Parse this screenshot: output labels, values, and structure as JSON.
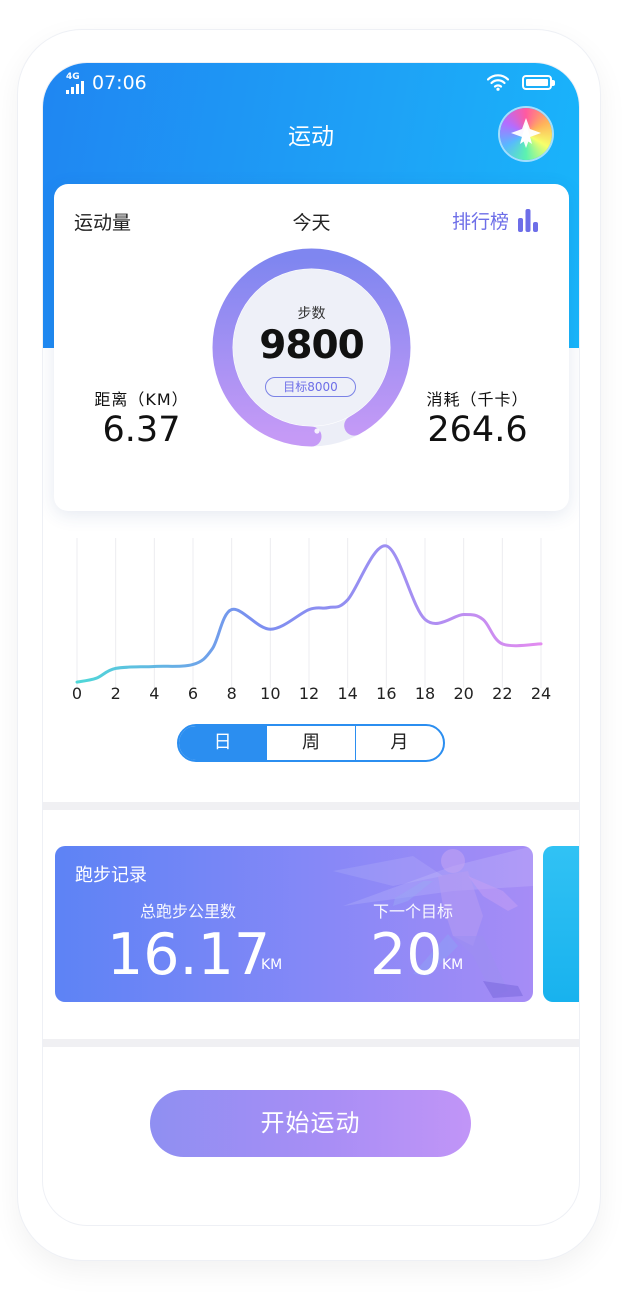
{
  "status": {
    "network": "4G",
    "time": "07:06"
  },
  "header": {
    "title": "运动"
  },
  "summary": {
    "label_left": "运动量",
    "label_center": "今天",
    "rank_label": "排行榜",
    "steps_label": "步数",
    "steps_value": "9800",
    "goal_label": "目标8000",
    "progress": 0.92,
    "distance_label": "距离（KM）",
    "distance_value": "6.37",
    "calories_label": "消耗（千卡）",
    "calories_value": "264.6"
  },
  "chart_data": {
    "type": "line",
    "x": [
      0,
      1,
      2,
      4,
      6,
      7,
      8,
      10,
      12,
      13,
      14,
      16,
      18,
      20,
      21,
      22,
      24
    ],
    "series": [
      {
        "values": [
          6,
          10,
          20,
          22,
          24,
          40,
          80,
          60,
          80,
          82,
          90,
          145,
          70,
          75,
          70,
          45,
          45
        ]
      }
    ],
    "xticks": [
      "0",
      "2",
      "4",
      "6",
      "8",
      "10",
      "12",
      "14",
      "16",
      "18",
      "20",
      "22",
      "24"
    ],
    "xlim": [
      0,
      24
    ],
    "ylim": [
      0,
      150
    ],
    "grid": "vertical",
    "colors": [
      "#4fd8d8",
      "#7a8ef0",
      "#a48ff2",
      "#e38cf0"
    ]
  },
  "period_tabs": [
    {
      "label": "日",
      "active": true
    },
    {
      "label": "周",
      "active": false
    },
    {
      "label": "月",
      "active": false
    }
  ],
  "running": {
    "title": "跑步记录",
    "total_label": "总跑步公里数",
    "total_value": "16.17",
    "total_unit": "KM",
    "next_label": "下一个目标",
    "next_value": "20",
    "next_unit": "KM"
  },
  "start_button": {
    "label": "开始运动"
  }
}
